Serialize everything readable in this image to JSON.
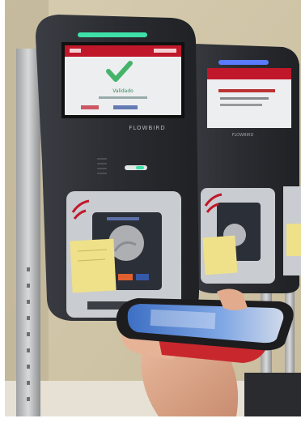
{
  "photo": {
    "colors": {
      "wall": "#dcd2b8",
      "validator_body": "#2c2e33",
      "screen_header": "#c0182a",
      "screen_bg": "#eceef0",
      "check_green": "#46b36b",
      "status_led_green": "#3fe0a8",
      "status_led_blue": "#5a7bff",
      "nfc_panel": "#c9ccd1",
      "sticky_note": "#efe08a",
      "phone_case": "#1d1d1f",
      "phone_screen": "#4a7fd6",
      "card_red": "#c8282d"
    },
    "validator_left": {
      "brand_label": "FLOWBIRD",
      "screen_small_text": "Validado"
    },
    "validator_right": {
      "brand_label": "FLOWBIRD"
    }
  }
}
